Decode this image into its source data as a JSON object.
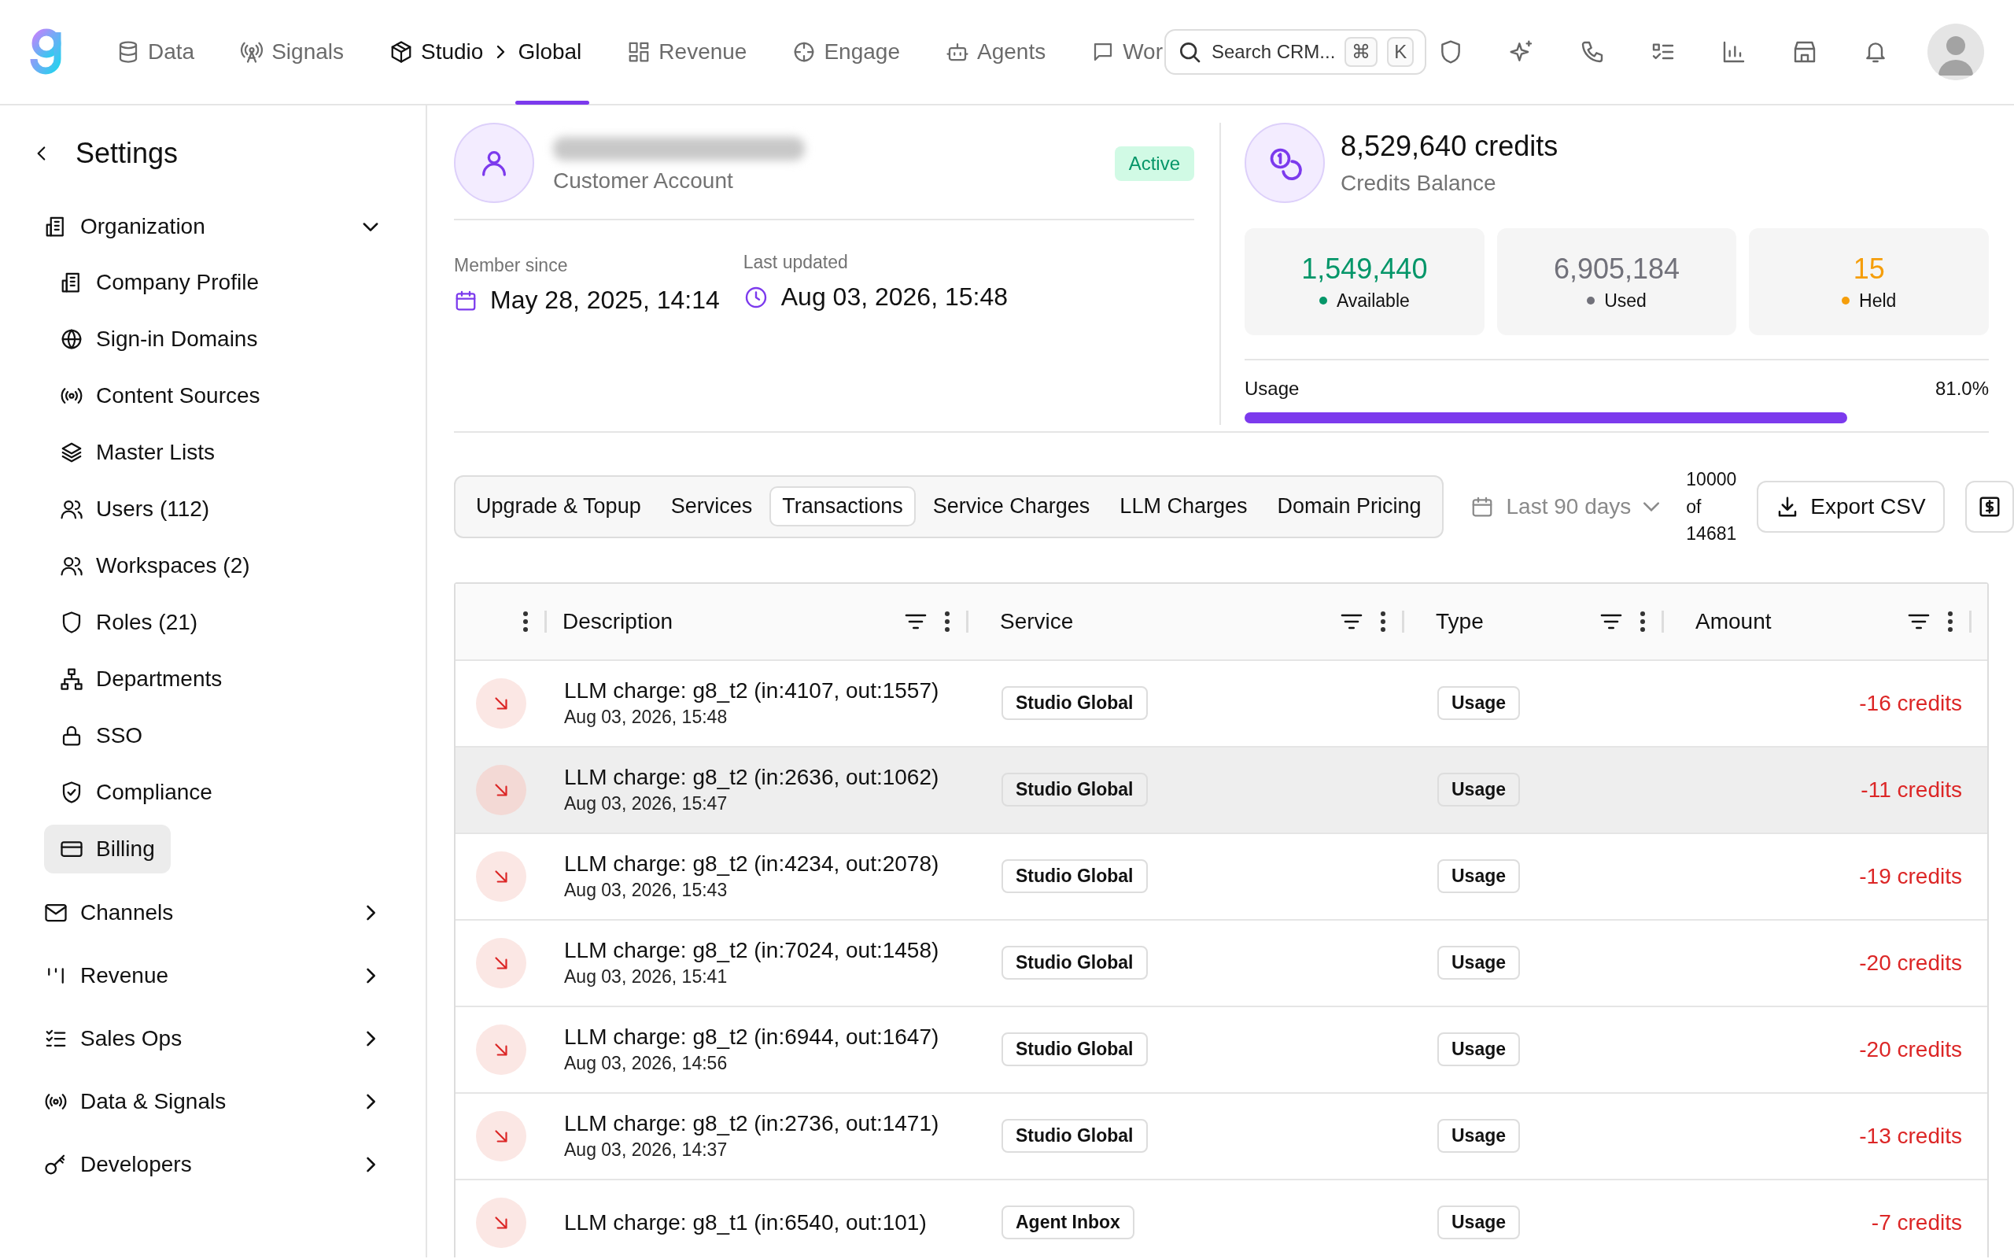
{
  "nav": [
    {
      "label": "Data",
      "selected": false
    },
    {
      "label": "Signals",
      "selected": false
    },
    {
      "label": "Studio",
      "sublabel": "Global",
      "selected": true
    },
    {
      "label": "Revenue",
      "selected": false
    },
    {
      "label": "Engage",
      "selected": false
    },
    {
      "label": "Agents",
      "selected": false
    },
    {
      "label": "Wor",
      "selected": false
    }
  ],
  "search": {
    "placeholder": "Search CRM...",
    "keys": [
      "⌘",
      "K"
    ]
  },
  "sidebar": {
    "title": "Settings",
    "sections": [
      {
        "label": "Organization",
        "expanded": true,
        "children": [
          {
            "label": "Company Profile",
            "selected": false
          },
          {
            "label": "Sign-in Domains",
            "selected": false
          },
          {
            "label": "Content Sources",
            "selected": false
          },
          {
            "label": "Master Lists",
            "selected": false
          },
          {
            "label": "Users (112)",
            "selected": false
          },
          {
            "label": "Workspaces (2)",
            "selected": false
          },
          {
            "label": "Roles (21)",
            "selected": false
          },
          {
            "label": "Departments",
            "selected": false
          },
          {
            "label": "SSO",
            "selected": false
          },
          {
            "label": "Compliance",
            "selected": false
          },
          {
            "label": "Billing",
            "selected": true
          }
        ]
      },
      {
        "label": "Channels",
        "expanded": false
      },
      {
        "label": "Revenue",
        "expanded": false
      },
      {
        "label": "Sales Ops",
        "expanded": false
      },
      {
        "label": "Data & Signals",
        "expanded": false
      },
      {
        "label": "Developers",
        "expanded": false
      }
    ]
  },
  "account": {
    "subtitle": "Customer Account",
    "status": "Active",
    "member_since_label": "Member since",
    "member_since": "May 28, 2025, 14:14",
    "last_updated_label": "Last updated",
    "last_updated": "Aug 03, 2026, 15:48"
  },
  "credits": {
    "balance": "8,529,640 credits",
    "balance_label": "Credits Balance",
    "stats": [
      {
        "value": "1,549,440",
        "label": "Available",
        "color": "#059669"
      },
      {
        "value": "6,905,184",
        "label": "Used",
        "color": "#71717a"
      },
      {
        "value": "15",
        "label": "Held",
        "color": "#f59e0b"
      }
    ],
    "usage_label": "Usage",
    "usage_reading": "81.0%",
    "level": 0.81
  },
  "tabs": [
    {
      "label": "Upgrade & Topup",
      "selected": false
    },
    {
      "label": "Services",
      "selected": false
    },
    {
      "label": "Transactions",
      "selected": true
    },
    {
      "label": "Service Charges",
      "selected": false
    },
    {
      "label": "LLM Charges",
      "selected": false
    },
    {
      "label": "Domain Pricing",
      "selected": false
    }
  ],
  "date_filter": "Last 90 days",
  "count": "10000 of 14681",
  "export_button": "Export CSV",
  "table": {
    "columns": [
      "Description",
      "Service",
      "Type",
      "Amount"
    ],
    "rows": [
      {
        "description": "LLM charge: g8_t2 (in:4107, out:1557)",
        "date": "Aug 03, 2026, 15:48",
        "service": "Studio Global",
        "type": "Usage",
        "amount": "-16 credits",
        "selected": false
      },
      {
        "description": "LLM charge: g8_t2 (in:2636, out:1062)",
        "date": "Aug 03, 2026, 15:47",
        "service": "Studio Global",
        "type": "Usage",
        "amount": "-11 credits",
        "selected": true
      },
      {
        "description": "LLM charge: g8_t2 (in:4234, out:2078)",
        "date": "Aug 03, 2026, 15:43",
        "service": "Studio Global",
        "type": "Usage",
        "amount": "-19 credits",
        "selected": false
      },
      {
        "description": "LLM charge: g8_t2 (in:7024, out:1458)",
        "date": "Aug 03, 2026, 15:41",
        "service": "Studio Global",
        "type": "Usage",
        "amount": "-20 credits",
        "selected": false
      },
      {
        "description": "LLM charge: g8_t2 (in:6944, out:1647)",
        "date": "Aug 03, 2026, 14:56",
        "service": "Studio Global",
        "type": "Usage",
        "amount": "-20 credits",
        "selected": false
      },
      {
        "description": "LLM charge: g8_t2 (in:2736, out:1471)",
        "date": "Aug 03, 2026, 14:37",
        "service": "Studio Global",
        "type": "Usage",
        "amount": "-13 credits",
        "selected": false
      },
      {
        "description": "LLM charge: g8_t1 (in:6540, out:101)",
        "service": "Agent Inbox",
        "type": "Usage",
        "amount": "-7 credits",
        "selected": false
      }
    ]
  }
}
